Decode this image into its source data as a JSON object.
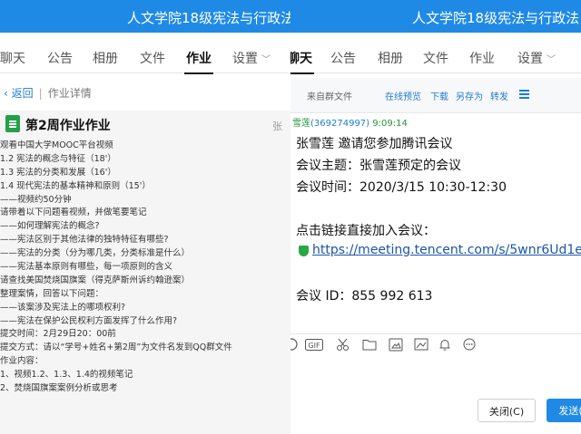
{
  "left": {
    "title": "人文学院18级宪法与行政法",
    "tabs": [
      {
        "label": "聊天",
        "active": false
      },
      {
        "label": "公告",
        "active": false
      },
      {
        "label": "相册",
        "active": false
      },
      {
        "label": "文件",
        "active": false
      },
      {
        "label": "作业",
        "active": true
      },
      {
        "label": "设置",
        "active": false,
        "dropdown": true
      }
    ],
    "back_label": "返回",
    "breadcrumb": "作业详情",
    "homework_title": "第2周作业作业",
    "author_cut": "张",
    "lines": [
      "观看中国大学MOOC平台视频",
      "  1.2 宪法的概念与特征（18'）",
      "  1.3 宪法的分类和发展（16'）",
      "  1.4 现代宪法的基本精神和原则（15'）",
      "  ——视频约50分钟",
      "请带着以下问题看视频，并做笔要笔记",
      "  ——如何理解宪法的概念?",
      "  ——宪法区别于其他法律的独特特征有哪些?",
      "  ——宪法的分类（分为哪几类，分类标准是什么）",
      "  ——宪法基本原则有哪些，每一项原则的含义",
      "请查找美国焚烧国旗案（得克萨斯州诉约翰逊案）",
      "整理案情，回答以下问题：",
      "     ——该案涉及宪法上的哪项权利?",
      "     ——宪法在保护公民权利方面发挥了什么作用?",
      "提交时间：2月29日20：00前",
      "提交方式：请以“学号+姓名+第2周”为文件名发到QQ群文件",
      "作业内容：",
      "      1、视频1.2、1.3、1.4的视频笔记",
      "      2、焚烧国旗案案例分析或思考"
    ]
  },
  "right": {
    "title": "人文学院18级宪法与行政法",
    "tabs": [
      {
        "label": "聊天",
        "active": true
      },
      {
        "label": "公告",
        "active": false
      },
      {
        "label": "相册",
        "active": false
      },
      {
        "label": "文件",
        "active": false
      },
      {
        "label": "作业",
        "active": false
      },
      {
        "label": "设置",
        "active": false,
        "dropdown": true
      }
    ],
    "file_source": "来自群文件",
    "file_actions": [
      "在线预览",
      "下载",
      "另存为",
      "转发"
    ],
    "sender_name": "雪莲",
    "sender_qq": "(369274997)",
    "sender_time": "9:09:14",
    "message": {
      "line1": "张雪莲 邀请您参加腾讯会议",
      "line2": "会议主题：张雪莲预定的会议",
      "line3": "会议时间：2020/3/15 10:30-12:30",
      "line4": "点击链接直接加入会议：",
      "link": "https://meeting.tencent.com/s/5wnr6Ud1e7",
      "line5": "会议 ID：855 992 613"
    },
    "composer_icons": [
      "emoji-icon",
      "gif-icon",
      "scissors-icon",
      "folder-icon",
      "image-gallery-icon",
      "image-icon",
      "bell-icon",
      "more-icon"
    ],
    "gif_label": "GIF",
    "close_label": "关闭(C)",
    "send_label": "发送(S"
  },
  "colors": {
    "titlebar": "#1f8ae6",
    "link": "#1a56a8",
    "accent": "#1f7bd4",
    "sender": "#24963a"
  }
}
